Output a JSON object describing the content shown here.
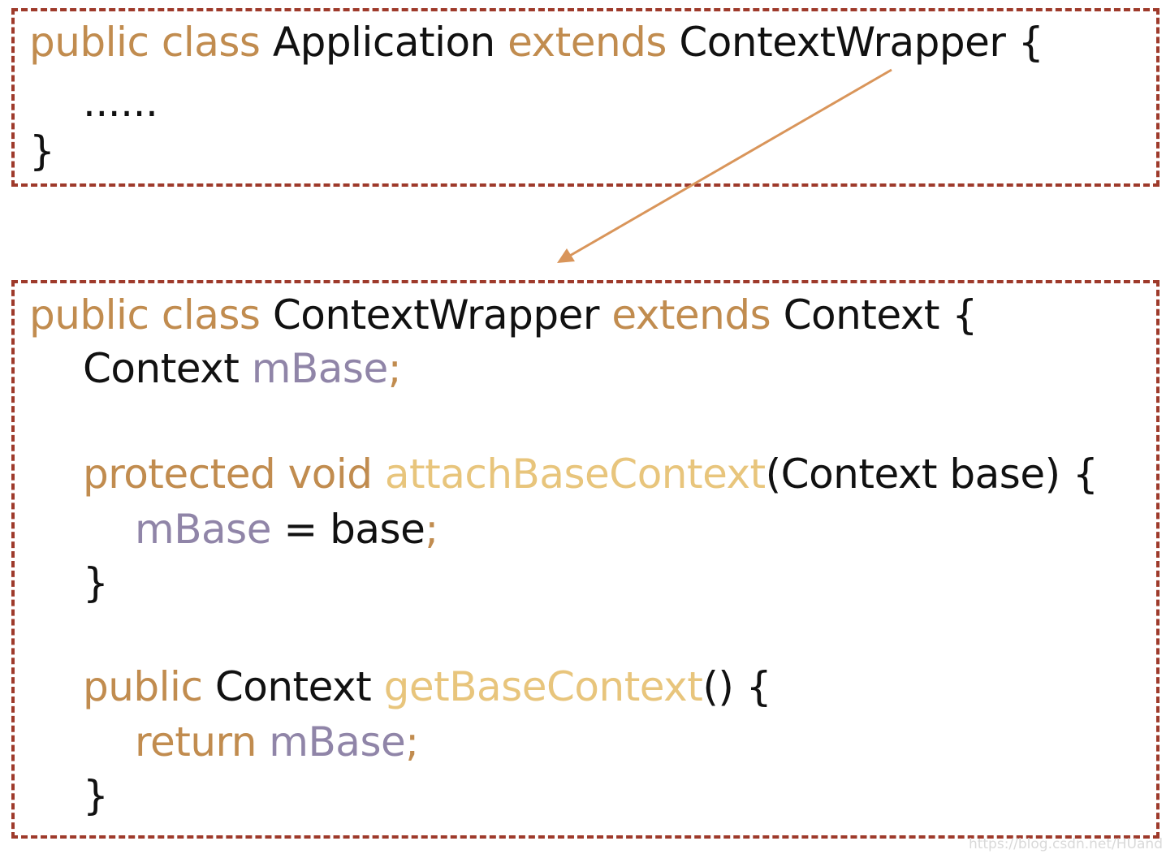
{
  "top_box": {
    "line1": {
      "kw1": "public class",
      "class_name": "Application",
      "kw2": "extends",
      "parent": "ContextWrapper {"
    },
    "ellipsis": "......",
    "close": "}"
  },
  "bottom_box": {
    "line1": {
      "kw1": "public class",
      "class_name": "ContextWrapper",
      "kw2": "extends",
      "parent": "Context {"
    },
    "field": {
      "type": "Context",
      "name": "mBase",
      "semicolon": ";"
    },
    "attach_method": {
      "kw": "protected void",
      "name": "attachBaseContext",
      "params": "(Context base) {"
    },
    "assign": {
      "var": "mBase",
      "rest": "= base",
      "semicolon": ";"
    },
    "close1": "}",
    "get_method": {
      "kw": "public",
      "type": "Context",
      "name": "getBaseContext",
      "rest": "() {"
    },
    "return_stmt": {
      "kw": "return",
      "var": "mBase",
      "semicolon": ";"
    },
    "close2": "}"
  },
  "colors": {
    "border": "#9e3a2b",
    "keyword": "#c18c4f",
    "method": "#e8c57c",
    "variable": "#9085a8",
    "arrow": "#d9955a"
  },
  "watermark": "https://blog.csdn.net/HUand"
}
